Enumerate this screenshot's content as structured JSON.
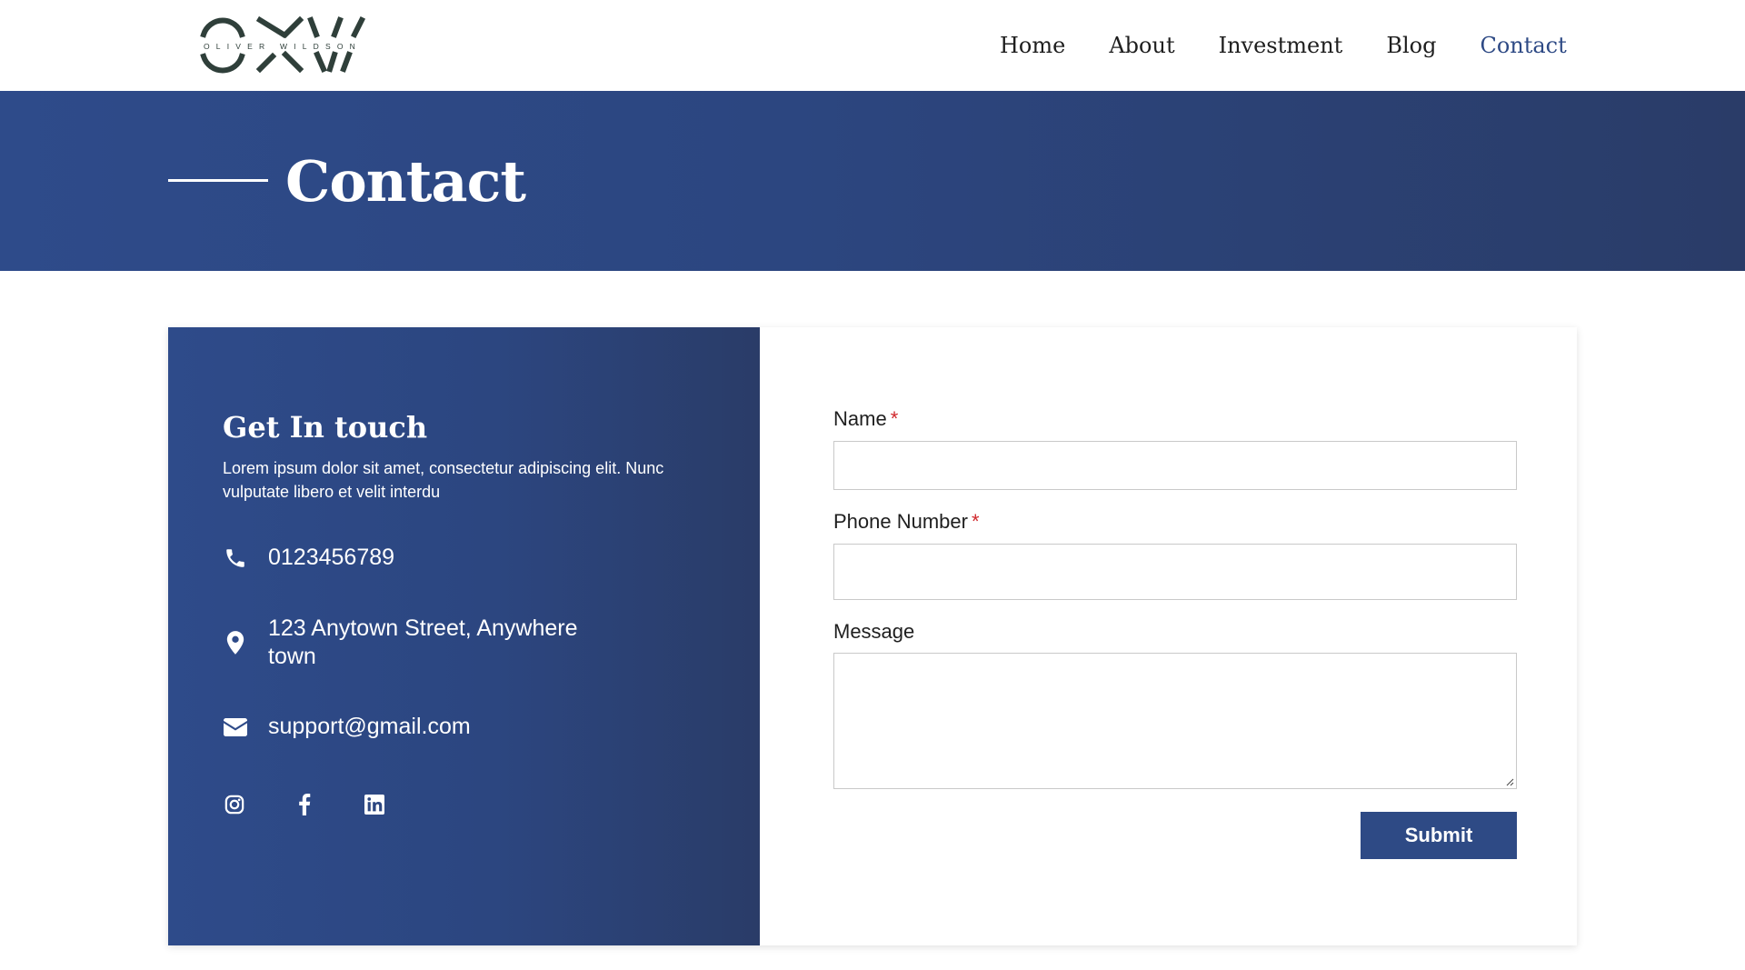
{
  "header": {
    "logo": {
      "monogram": "OXW",
      "tagline": "OLIVER WILDSON",
      "color": "#2f3f3a"
    },
    "nav": [
      {
        "label": "Home",
        "active": false
      },
      {
        "label": "About",
        "active": false
      },
      {
        "label": "Investment",
        "active": false
      },
      {
        "label": "Blog",
        "active": false
      },
      {
        "label": "Contact",
        "active": true
      }
    ]
  },
  "banner": {
    "title": "Contact"
  },
  "contact_info": {
    "title": "Get In touch",
    "description": "Lorem ipsum dolor sit amet, consectetur adipiscing elit. Nunc vulputate libero et velit interdu",
    "phone": {
      "icon": "phone-icon",
      "text": "0123456789"
    },
    "address": {
      "icon": "map-pin-icon",
      "text": "123 Anytown Street, Anywhere town"
    },
    "email": {
      "icon": "envelope-icon",
      "text": "support@gmail.com"
    },
    "social": [
      "instagram-icon",
      "facebook-icon",
      "linkedin-icon"
    ]
  },
  "form": {
    "name": {
      "label": "Name",
      "required_mark": "*",
      "value": ""
    },
    "phone": {
      "label": "Phone Number",
      "required_mark": "*",
      "value": ""
    },
    "message": {
      "label": "Message",
      "value": ""
    },
    "submit_label": "Submit"
  },
  "colors": {
    "brand_blue": "#2e4a85",
    "required": "#d0282c",
    "nav_active": "#2e4a85"
  }
}
